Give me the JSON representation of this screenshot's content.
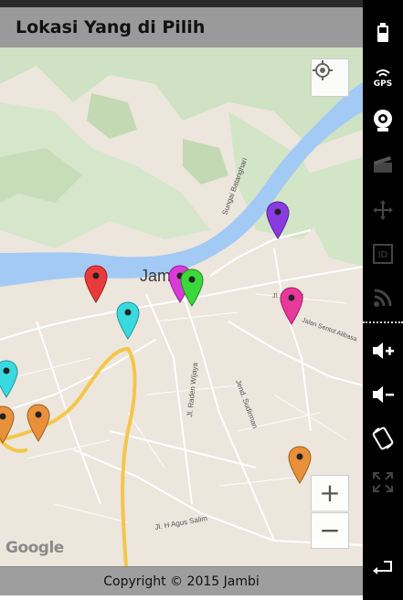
{
  "app": {
    "title": "Lokasi Yang di Pilih",
    "footer": "Copyright © 2015 Jambi"
  },
  "map": {
    "city_label": "Jambi",
    "attribution": "Google",
    "street_labels": [
      "Sungai Batanghari",
      "Jl. Raden Wijaya",
      "Jend. Sudirman",
      "Jl. H Agus Salim",
      "Jalan Sentot Alibasa",
      "Jl. Mekurat"
    ],
    "zoom_in_label": "+",
    "zoom_out_label": "−",
    "markers": [
      {
        "color": "#e83a3a",
        "name": "red"
      },
      {
        "color": "#d93bd6",
        "name": "magenta"
      },
      {
        "color": "#3bd83b",
        "name": "green"
      },
      {
        "color": "#8a3be0",
        "name": "purple"
      },
      {
        "color": "#e8389a",
        "name": "pink"
      },
      {
        "color": "#3ad9e0",
        "name": "cyan"
      },
      {
        "color": "#3ad9e0",
        "name": "cyan-left"
      },
      {
        "color": "#e8903a",
        "name": "orange-1"
      },
      {
        "color": "#e8903a",
        "name": "orange-2"
      },
      {
        "color": "#e8903a",
        "name": "orange-3"
      }
    ]
  },
  "sidebar": {
    "icons": [
      "battery-icon",
      "gps-icon",
      "webcam-icon",
      "camera-clapper-icon",
      "move-arrows-icon",
      "id-icon",
      "rss-icon",
      "volume-up-icon",
      "volume-down-icon",
      "rotate-icon",
      "fullscreen-icon",
      "back-icon"
    ],
    "gps_text": "GPS",
    "id_text": "ID"
  }
}
